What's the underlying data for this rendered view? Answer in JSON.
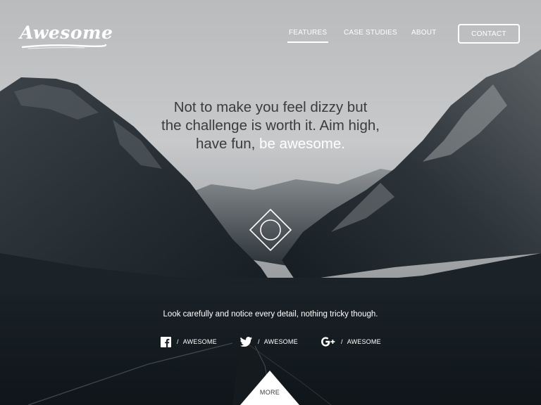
{
  "brand": {
    "logo_text": "Awesome"
  },
  "nav": {
    "items": [
      {
        "label": "FEATURES",
        "active": true
      },
      {
        "label": "CASE STUDIES",
        "active": false
      },
      {
        "label": "ABOUT",
        "active": false
      }
    ],
    "contact_label": "CONTACT"
  },
  "hero": {
    "line1": "Not to make you feel dizzy but",
    "line2": "the challenge is worth it. Aim high,",
    "line3_start": "have fun, ",
    "line3_highlight": "be awesome."
  },
  "tagline": "Look carefully and notice every detail, nothing tricky though.",
  "social": [
    {
      "icon": "facebook-icon",
      "separator": "/",
      "label": "AWESOME"
    },
    {
      "icon": "twitter-icon",
      "separator": "/",
      "label": "AWESOME"
    },
    {
      "icon": "google-plus-icon",
      "separator": "/",
      "label": "AWESOME"
    }
  ],
  "more_label": "MORE",
  "colors": {
    "sky": "#c2c4c6",
    "mountain_dark": "#1f272d",
    "accent_white": "#ffffff"
  }
}
